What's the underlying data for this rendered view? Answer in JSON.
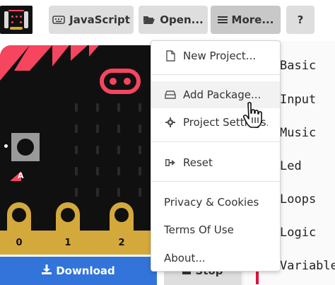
{
  "toolbar": {
    "javascript_label": "JavaScript",
    "open_label": "Open...",
    "more_label": "More...",
    "help_label": "?"
  },
  "menu": {
    "items": [
      {
        "label": "New Project...",
        "icon": "file-icon"
      },
      {
        "label": "Add Package...",
        "icon": "hard-drive-icon"
      },
      {
        "label": "Project Settings...",
        "icon": "gear-icon"
      },
      {
        "label": "Reset",
        "icon": "sign-out-icon"
      },
      {
        "label": "Privacy & Cookies"
      },
      {
        "label": "Terms Of Use"
      },
      {
        "label": "About..."
      }
    ]
  },
  "categories": [
    {
      "label": "Basic",
      "color": "#1e90ff"
    },
    {
      "label": "Input",
      "color": "#d400d4"
    },
    {
      "label": "Music",
      "color": "#e63022"
    },
    {
      "label": "Led",
      "color": "#5c2d91"
    },
    {
      "label": "Loops",
      "color": "#00aa00"
    },
    {
      "label": "Logic",
      "color": "#00a4a6"
    },
    {
      "label": "Variables",
      "color": "#dc143c"
    }
  ],
  "simulator": {
    "pins": [
      "0",
      "1",
      "2"
    ],
    "button_a_label": "A"
  },
  "actions": {
    "download_label": "Download",
    "stop_label": "Stop"
  },
  "colors": {
    "accent_blue": "#3274d9",
    "board_red": "#f5455f",
    "pin_gold": "#d4a93b"
  }
}
